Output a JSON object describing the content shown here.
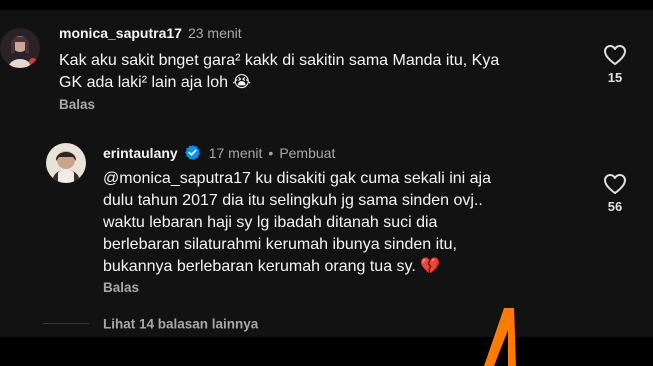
{
  "comments": [
    {
      "username": "monica_saputra17",
      "time": "23 menit",
      "text": "Kak aku sakit bnget gara² kakk di sakitin sama Manda itu, Kya\nGK ada laki² lain aja loh 😭",
      "reply_label": "Balas",
      "likes": "15"
    },
    {
      "username": "erintaulany",
      "verified": true,
      "time": "17 menit",
      "separator": "•",
      "creator_label": "Pembuat",
      "text": "@monica_saputra17 ku disakiti gak cuma sekali ini aja\ndulu tahun 2017 dia itu selingkuh jg sama sinden ovj..\nwaktu lebaran haji sy lg ibadah ditanah suci dia\nberlebaran silaturahmi kerumah ibunya sinden itu,\nbukannya berlebaran kerumah orang tua sy. 💔",
      "reply_label": "Balas",
      "likes": "56"
    }
  ],
  "view_replies_label": "Lihat 14 balasan lainnya",
  "icons": {
    "like": "heart-outline-icon",
    "verified": "verified-badge-icon"
  },
  "colors": {
    "background": "#121212",
    "text_primary": "#f5f5f5",
    "text_secondary": "#a8a8a8",
    "verified_blue": "#0095f6",
    "overlay_arrow": "#ff7a00"
  }
}
